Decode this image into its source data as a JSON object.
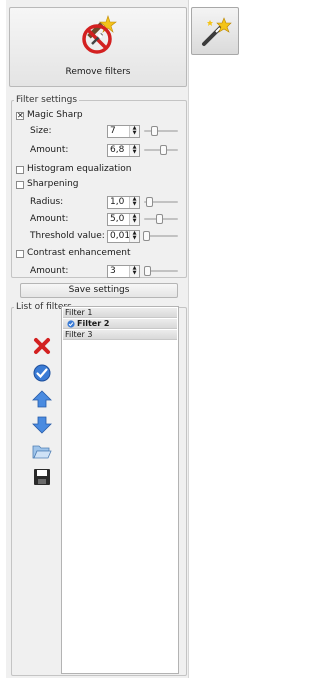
{
  "remove_button": {
    "label": "Remove filters"
  },
  "filter_settings": {
    "title": "Filter settings",
    "magic_sharp": {
      "label": "Magic Sharp",
      "checked": true,
      "size": {
        "label": "Size:",
        "value": "7",
        "level": 0.3
      },
      "amount": {
        "label": "Amount:",
        "value": "6,8",
        "level": 0.55
      }
    },
    "histogram": {
      "label": "Histogram equalization",
      "checked": false
    },
    "sharpening": {
      "label": "Sharpening",
      "checked": false,
      "radius": {
        "label": "Radius:",
        "value": "1,0",
        "level": 0.15
      },
      "amount": {
        "label": "Amount:",
        "value": "5,0",
        "level": 0.45
      },
      "threshold": {
        "label": "Threshold value:",
        "value": "0,01",
        "level": 0.05
      }
    },
    "contrast": {
      "label": "Contrast enhancement",
      "checked": false,
      "amount": {
        "label": "Amount:",
        "value": "3",
        "level": 0.1
      }
    },
    "save_label": "Save settings"
  },
  "list_of_filters": {
    "title": "List of filters",
    "items": [
      {
        "label": "Filter 1"
      },
      {
        "label": "Filter 2"
      },
      {
        "label": "Filter 3"
      }
    ]
  },
  "icons": {
    "remove": "remove-filters-icon",
    "wand": "magic-wand-icon",
    "delete": "delete-icon",
    "apply": "apply-check-icon",
    "up": "arrow-up-icon",
    "down": "arrow-down-icon",
    "open": "folder-open-icon",
    "save": "floppy-disk-icon"
  },
  "colors": {
    "accent_red": "#d32020",
    "accent_blue": "#3a7bd5"
  }
}
